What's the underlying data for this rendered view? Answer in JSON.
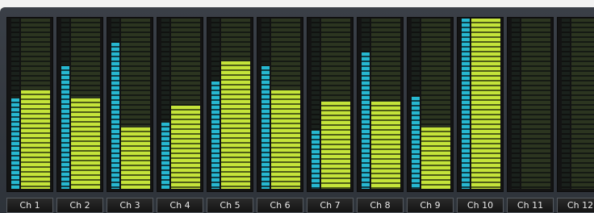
{
  "channels": [
    {
      "label": "Ch 1",
      "peak_level": 0.53,
      "level": 0.58
    },
    {
      "label": "Ch 2",
      "peak_level": 0.72,
      "level": 0.53
    },
    {
      "label": "Ch 3",
      "peak_level": 0.86,
      "level": 0.36
    },
    {
      "label": "Ch 4",
      "peak_level": 0.39,
      "level": 0.49
    },
    {
      "label": "Ch 5",
      "peak_level": 0.63,
      "level": 0.75
    },
    {
      "label": "Ch 6",
      "peak_level": 0.72,
      "level": 0.58
    },
    {
      "label": "Ch 7",
      "peak_level": 0.34,
      "level": 0.51
    },
    {
      "label": "Ch 8",
      "peak_level": 0.8,
      "level": 0.51
    },
    {
      "label": "Ch 9",
      "peak_level": 0.54,
      "level": 0.36
    },
    {
      "label": "Ch 10",
      "peak_level": 1.0,
      "level": 1.0
    },
    {
      "label": "Ch 11",
      "peak_level": 0,
      "level": 0
    },
    {
      "label": "Ch 12",
      "peak_level": 0,
      "level": 0
    }
  ],
  "colors": {
    "panel": "#353a42",
    "peak_bar": "#27b8d1",
    "level_bar": "#c5e43a",
    "meter_background": "#131313"
  }
}
